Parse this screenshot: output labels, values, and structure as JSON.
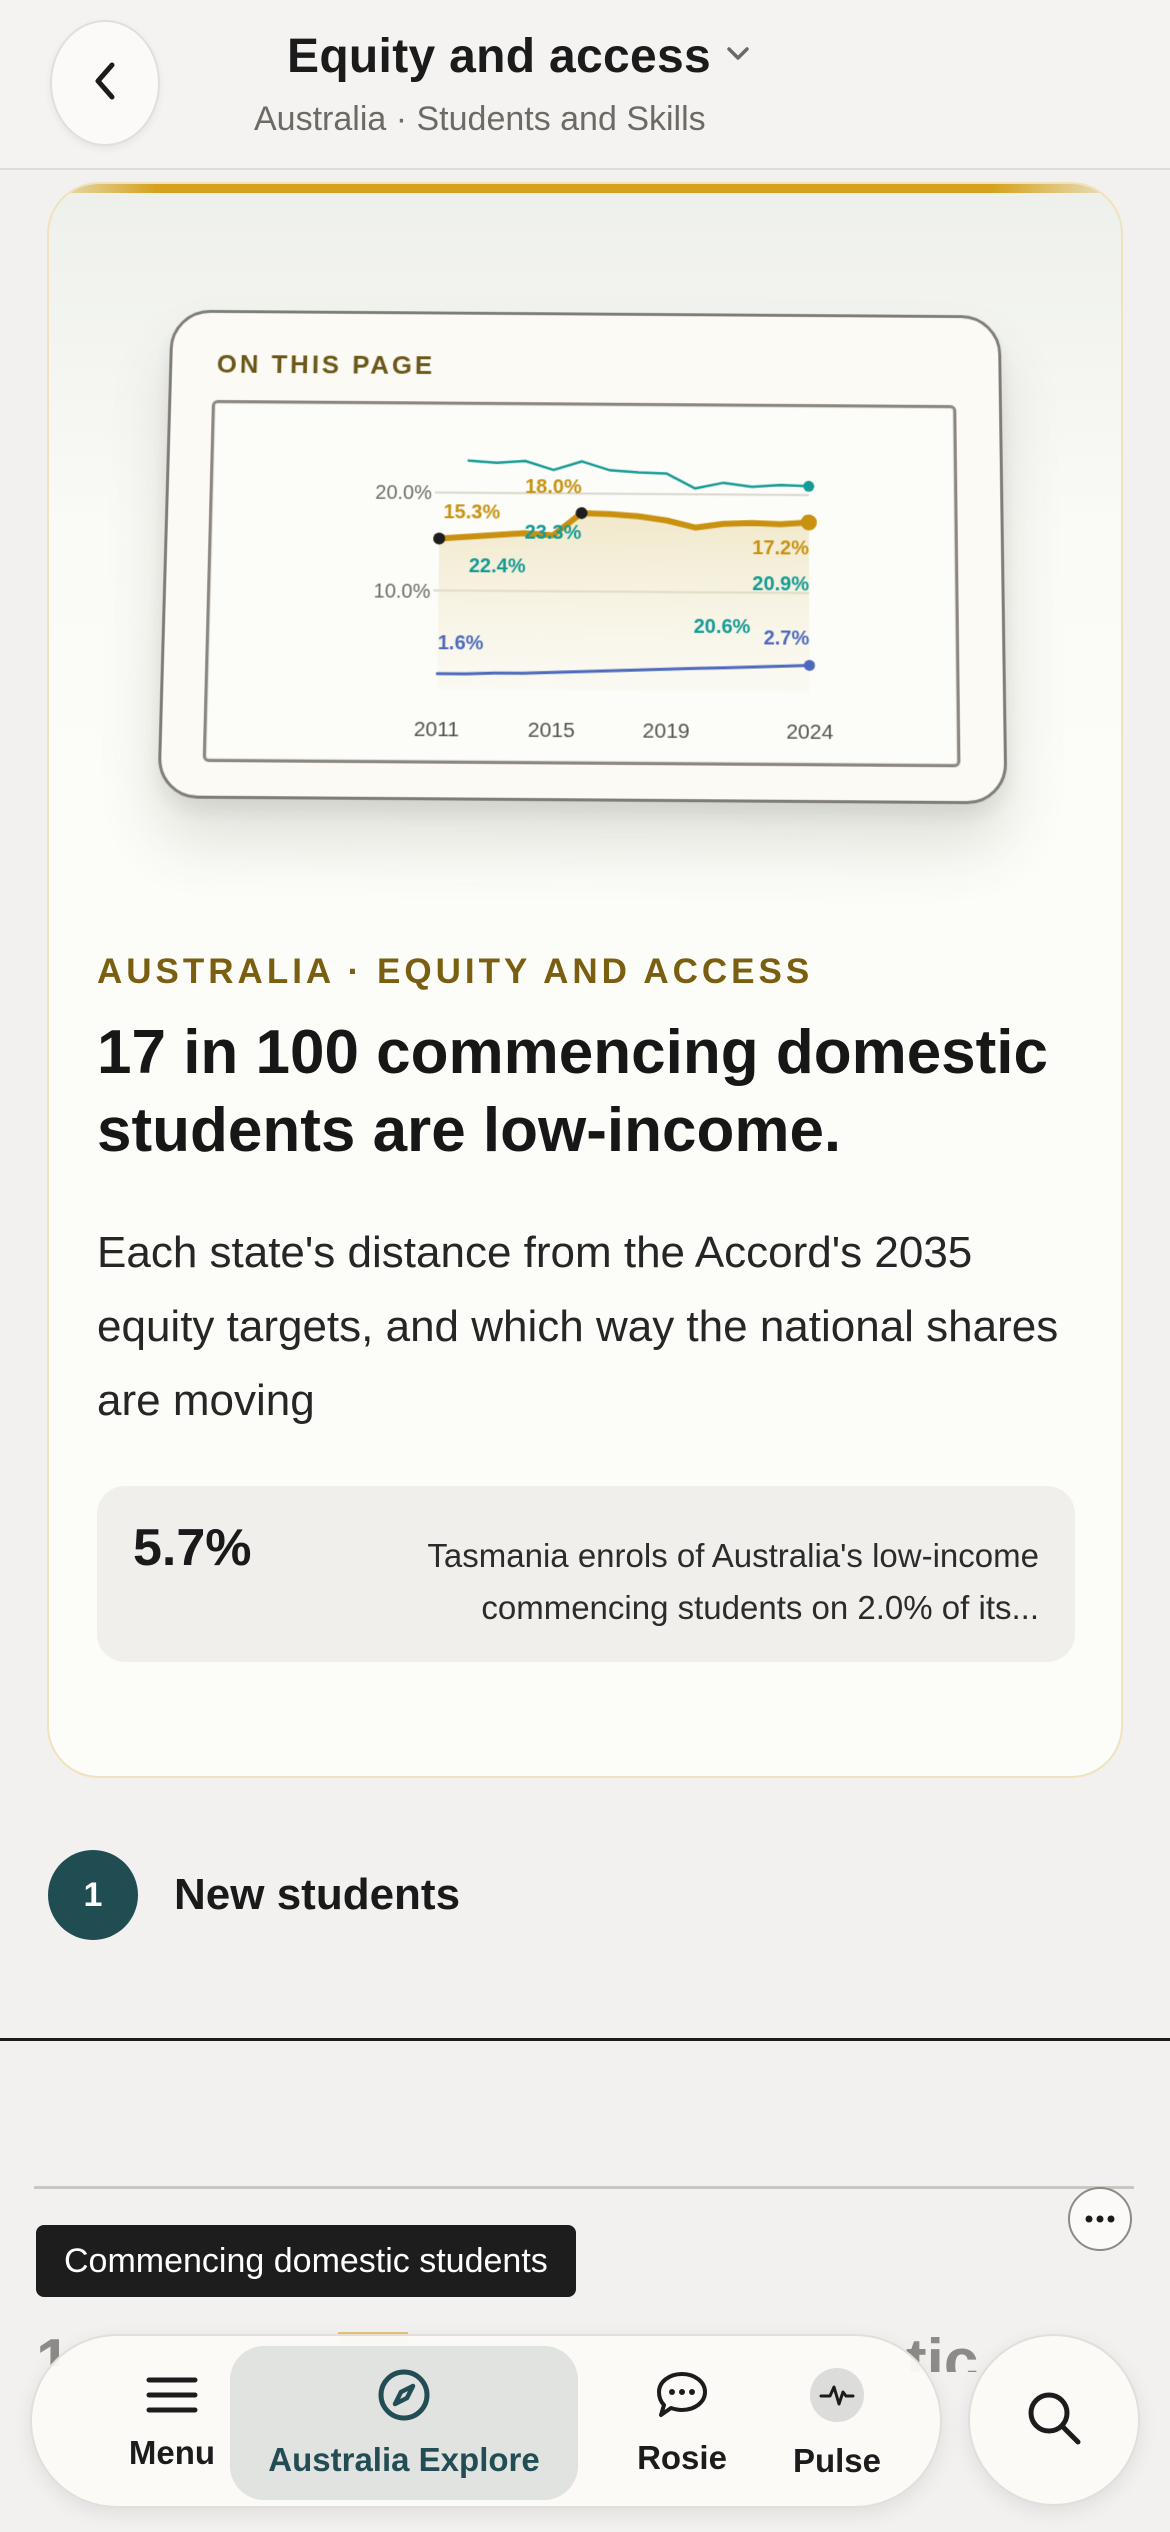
{
  "header": {
    "title": "Equity and access",
    "subtitle": "Australia · Students and Skills"
  },
  "hero": {
    "preview_label": "ON THIS PAGE",
    "kicker": "AUSTRALIA · EQUITY AND ACCESS",
    "headline": "17 in 100 commencing domestic students are low-income.",
    "dek": "Each state's distance from the Accord's 2035 equity targets, and which way the national shares are moving",
    "stat": {
      "value": "5.7%",
      "description": "Tasmania enrols of Australia's low-income commencing students on 2.0% of its..."
    }
  },
  "chart_data": {
    "type": "line",
    "x": [
      2011,
      2012,
      2013,
      2014,
      2015,
      2016,
      2017,
      2018,
      2019,
      2020,
      2021,
      2022,
      2023,
      2024
    ],
    "x_tick_labels": [
      "2011",
      "2015",
      "2019",
      "2024"
    ],
    "y_tick_labels": [
      "20.0%",
      "10.0%"
    ],
    "ylim": [
      0,
      25
    ],
    "series": [
      {
        "values": [
          null,
          23.3,
          23.1,
          23.3,
          22.4,
          23.3,
          22.4,
          22.2,
          22.1,
          20.6,
          21.2,
          20.8,
          21.0,
          20.9
        ],
        "color": "#139a94"
      },
      {
        "values": [
          15.3,
          15.5,
          15.7,
          15.9,
          15.7,
          18.0,
          17.9,
          17.7,
          17.3,
          16.6,
          17.0,
          17.1,
          17.0,
          17.2
        ],
        "color": "#c8910f"
      },
      {
        "values": [
          1.6,
          1.6,
          1.7,
          1.7,
          1.8,
          1.9,
          2.0,
          2.1,
          2.2,
          2.3,
          2.4,
          2.5,
          2.6,
          2.7
        ],
        "color": "#4d69bd"
      }
    ],
    "data_labels": {
      "gold_start": "15.3%",
      "gold_peak": "18.0%",
      "gold_end": "17.2%",
      "teal_a": "22.4%",
      "teal_b": "23.3%",
      "teal_c": "20.6%",
      "teal_end": "20.9%",
      "blue_start": "1.6%",
      "blue_end": "2.7%"
    }
  },
  "section": {
    "number": "1",
    "title": "New students"
  },
  "next_card": {
    "tooltip": "Commencing domestic students",
    "ghost_left": "1",
    "ghost_right": "tic"
  },
  "nav": {
    "items": [
      {
        "label": "Menu",
        "icon": "menu-icon"
      },
      {
        "label": "Australia Explore",
        "icon": "compass-icon"
      },
      {
        "label": "Rosie",
        "icon": "chat-icon"
      },
      {
        "label": "Pulse",
        "icon": "pulse-icon"
      }
    ],
    "search_icon": "search-icon"
  },
  "colors": {
    "accent_gold": "#d6a21d",
    "teal_dark": "#1f4d52",
    "kicker": "#7a5f10"
  }
}
